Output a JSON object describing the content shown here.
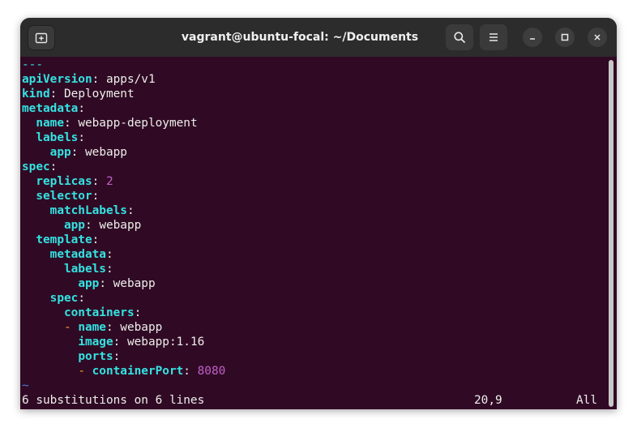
{
  "window": {
    "title": "vagrant@ubuntu-focal: ~/Documents"
  },
  "icons": {
    "new_tab": "new-tab-icon",
    "search": "search-icon",
    "menu": "hamburger-menu-icon",
    "minimize": "minimize-icon",
    "maximize": "maximize-icon",
    "close": "close-icon"
  },
  "colors": {
    "terminal_bg": "#300a24",
    "key": "#34e2e2",
    "text": "#eeeeec",
    "number": "#c061cb",
    "dash": "#f0a030",
    "tilde": "#4a7bd8",
    "titlebar": "#2c2c2c"
  },
  "editor": {
    "lines": [
      {
        "indent": "",
        "dash": "",
        "key": "---",
        "sep": "",
        "value": "",
        "vtype": "text"
      },
      {
        "indent": "",
        "dash": "",
        "key": "apiVersion",
        "sep": ":",
        "value": " apps/v1",
        "vtype": "text"
      },
      {
        "indent": "",
        "dash": "",
        "key": "kind",
        "sep": ":",
        "value": " Deployment",
        "vtype": "text"
      },
      {
        "indent": "",
        "dash": "",
        "key": "metadata",
        "sep": ":",
        "value": "",
        "vtype": "text"
      },
      {
        "indent": "  ",
        "dash": "",
        "key": "name",
        "sep": ":",
        "value": " webapp-deployment",
        "vtype": "text"
      },
      {
        "indent": "  ",
        "dash": "",
        "key": "labels",
        "sep": ":",
        "value": "",
        "vtype": "text"
      },
      {
        "indent": "    ",
        "dash": "",
        "key": "app",
        "sep": ":",
        "value": " webapp",
        "vtype": "text"
      },
      {
        "indent": "",
        "dash": "",
        "key": "spec",
        "sep": ":",
        "value": "",
        "vtype": "text"
      },
      {
        "indent": "  ",
        "dash": "",
        "key": "replicas",
        "sep": ":",
        "value": " 2",
        "vtype": "number"
      },
      {
        "indent": "  ",
        "dash": "",
        "key": "selector",
        "sep": ":",
        "value": "",
        "vtype": "text"
      },
      {
        "indent": "    ",
        "dash": "",
        "key": "matchLabels",
        "sep": ":",
        "value": "",
        "vtype": "text"
      },
      {
        "indent": "      ",
        "dash": "",
        "key": "app",
        "sep": ":",
        "value": " webapp",
        "vtype": "text"
      },
      {
        "indent": "  ",
        "dash": "",
        "key": "template",
        "sep": ":",
        "value": "",
        "vtype": "text"
      },
      {
        "indent": "    ",
        "dash": "",
        "key": "metadata",
        "sep": ":",
        "value": "",
        "vtype": "text"
      },
      {
        "indent": "      ",
        "dash": "",
        "key": "labels",
        "sep": ":",
        "value": "",
        "vtype": "text"
      },
      {
        "indent": "        ",
        "dash": "",
        "key": "app",
        "sep": ":",
        "value": " webapp",
        "vtype": "text"
      },
      {
        "indent": "    ",
        "dash": "",
        "key": "spec",
        "sep": ":",
        "value": "",
        "vtype": "text"
      },
      {
        "indent": "      ",
        "dash": "",
        "key": "containers",
        "sep": ":",
        "value": "",
        "vtype": "text"
      },
      {
        "indent": "      ",
        "dash": "- ",
        "key": "name",
        "sep": ":",
        "value": " webapp",
        "vtype": "text"
      },
      {
        "indent": "        ",
        "dash": "",
        "key": "image",
        "sep": ":",
        "value": " webapp:1.16",
        "vtype": "text"
      },
      {
        "indent": "        ",
        "dash": "",
        "key": "ports",
        "sep": ":",
        "value": "",
        "vtype": "text"
      },
      {
        "indent": "        ",
        "dash": "- ",
        "key": "containerPort",
        "sep": ":",
        "value": " 8080",
        "vtype": "number"
      }
    ],
    "tilde": "~",
    "status": {
      "message": "6 substitutions on 6 lines",
      "position": "20,9",
      "scroll": "All"
    }
  }
}
